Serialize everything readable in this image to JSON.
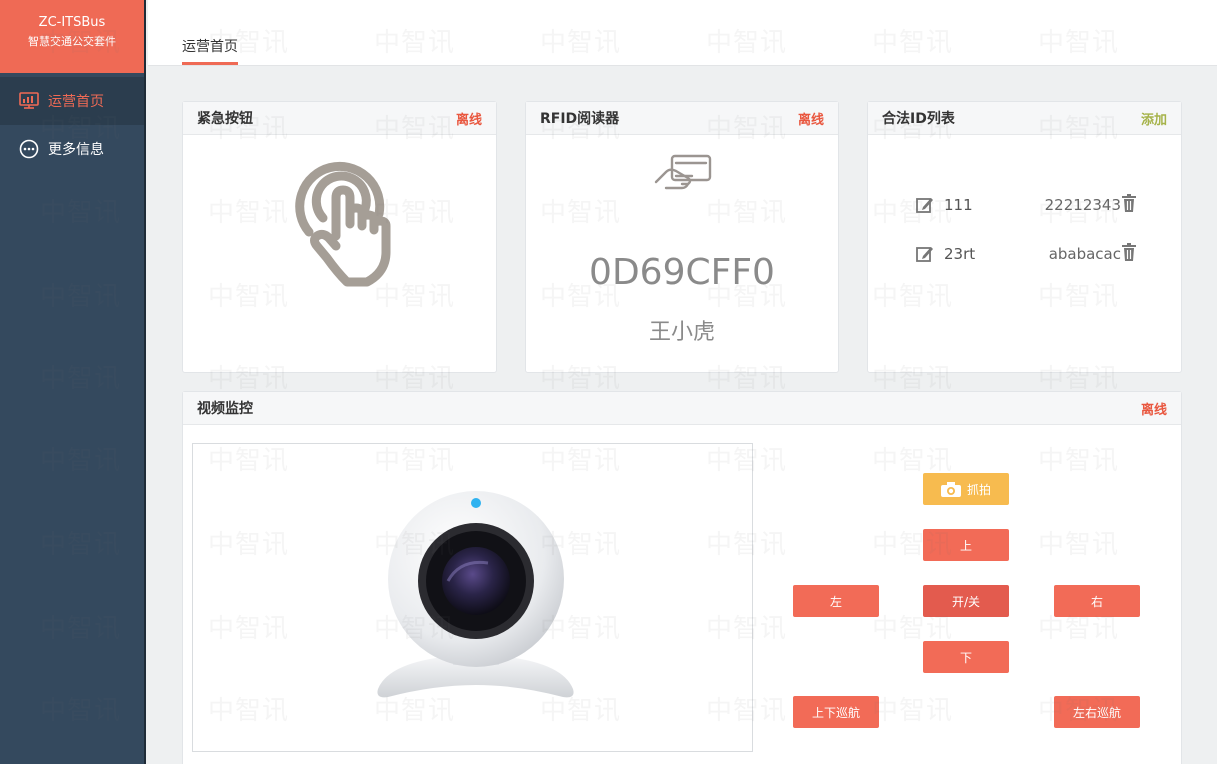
{
  "app": {
    "title": "ZC-ITSBus",
    "subtitle": "智慧交通公交套件"
  },
  "sidebar": {
    "items": [
      {
        "label": "运营首页",
        "icon": "dashboard-icon",
        "active": true
      },
      {
        "label": "更多信息",
        "icon": "more-icon",
        "active": false
      }
    ]
  },
  "topbar": {
    "tab": "运营首页"
  },
  "emergency": {
    "title": "紧急按钮",
    "status": "离线"
  },
  "rfid": {
    "title": "RFID阅读器",
    "status": "离线",
    "card_id": "0D69CFF0",
    "name": "王小虎"
  },
  "idlist": {
    "title": "合法ID列表",
    "add": "添加",
    "rows": [
      {
        "name": "111",
        "value": "22212343"
      },
      {
        "name": "23rt",
        "value": "ababacac"
      }
    ]
  },
  "video": {
    "title": "视频监控",
    "status": "离线",
    "buttons": {
      "capture": "抓拍",
      "up": "上",
      "down": "下",
      "left": "左",
      "right": "右",
      "power": "开/关",
      "tilt_cruise": "上下巡航",
      "pan_cruise": "左右巡航"
    }
  },
  "watermark": "中智讯",
  "colors": {
    "accent": "#ef6a55",
    "sidebar": "#34495e",
    "offline": "#e9573f",
    "add": "#a6b34a",
    "capture": "#f7bb4f"
  }
}
